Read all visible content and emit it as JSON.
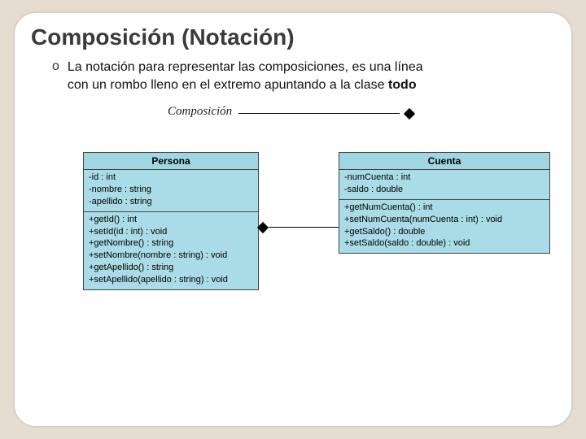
{
  "title": "Composición (Notación)",
  "bullet": {
    "marker": "o",
    "line1": "La notación para representar las composiciones, es una línea",
    "line2_a": "con un rombo lleno en el extremo apuntando a la clase ",
    "line2_b": "todo"
  },
  "legend": {
    "label": "Composición"
  },
  "persona": {
    "name": "Persona",
    "attrs": [
      "-id : int",
      "-nombre : string",
      "-apellido : string"
    ],
    "ops": [
      "+getId() : int",
      "+setId(id : int) : void",
      "+getNombre() : string",
      "+setNombre(nombre : string) : void",
      "+getApellido() : string",
      "+setApellido(apellido : string) : void"
    ]
  },
  "cuenta": {
    "name": "Cuenta",
    "attrs": [
      "-numCuenta : int",
      "-saldo : double"
    ],
    "ops": [
      "+getNumCuenta() : int",
      "+setNumCuenta(numCuenta : int) : void",
      "+getSaldo() : double",
      "+setSaldo(saldo : double) : void"
    ]
  }
}
